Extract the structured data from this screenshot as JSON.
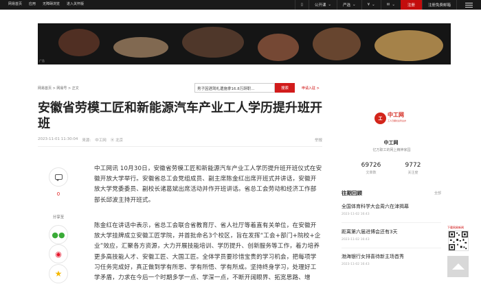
{
  "topbar": {
    "links": [
      "网易首页",
      "应用",
      "无障碍浏览",
      "进入关怀版"
    ],
    "right": {
      "publish": "公开课",
      "real_estate": "严选",
      "finance": "",
      "mail": "",
      "register": "注册",
      "login": "注册免费邮箱"
    }
  },
  "banner": {
    "tag": "广告"
  },
  "breadcrumb": "网易首页 > 网易号 > 正文",
  "search": {
    "value": "男子因酒驾札遭施拿16.8万辞职...",
    "button": "搜索"
  },
  "apply_link": "申请入驻 >",
  "article": {
    "title": "安徽省劳模工匠和新能源汽车产业工人学历提升班开班",
    "meta": {
      "datetime": "2023-11-01 11:30:04",
      "source_label": "来源:",
      "source": "中工网",
      "location": "北京",
      "report": "举报"
    },
    "comment_count": "0",
    "share_label": "分享至",
    "paragraphs": [
      "中工网讯 10月30日，安徽省劳模工匠和新能源汽车产业工人学历提升班开班仪式在安徽开放大学举行。安徽省总工会党组成员、副主席陈金红出席开班式并讲话，安徽开放大学党委委员、副校长诸葛斌出席活动并作开班讲话。省总工会劳动和经济工作部部长邱波主持开班式。",
      "陈金红在讲话中表示，省总工会联合省教育厅、省人社厅等着直有关单位，在安徽开放大学挂牌成立安徽工匠学院，并首批命名3个校区，旨在发挥“工会+部门+院校+企业”效应，汇聚各方资源，大力开展技能培训、学历提升、创新服务等工作，着力培养更多高技能人才、安徽工匠、大国工匠。全体学员要珍惜宝贵的学习机会，把每项学习任务完成好，真正做到学有所思、学有所悟、学有所成。坚持终身学习，处理好工学矛盾，力求在今后一个时期多学一点、学深一点，不断开阔眼界、拓宽思路、增"
    ]
  },
  "sidebar": {
    "logo_text": "中工网",
    "logo_sub": "工人日报社主管主办",
    "source_name": "中工网",
    "source_desc": "亿万职工的网上精神家园",
    "stats": [
      {
        "num": "69726",
        "label": "文章数"
      },
      {
        "num": "9772",
        "label": "关注度"
      }
    ],
    "review_title": "往期回顾",
    "review_all": "全部",
    "reviews": [
      {
        "title": "全国体育科学大会周六在津揭幕",
        "date": "2023-11-02 16:43"
      },
      {
        "title": "距离第六届进博会还有3天",
        "date": "2023-11-02 16:43"
      },
      {
        "title": "渤海银行女排喜待新主场首秀",
        "date": "2023-11-02 16:43"
      }
    ],
    "download_label": "下载网易新闻"
  },
  "colors": {
    "brand_red": "#d11b1b",
    "topbar_bg": "#1a1a1a"
  }
}
